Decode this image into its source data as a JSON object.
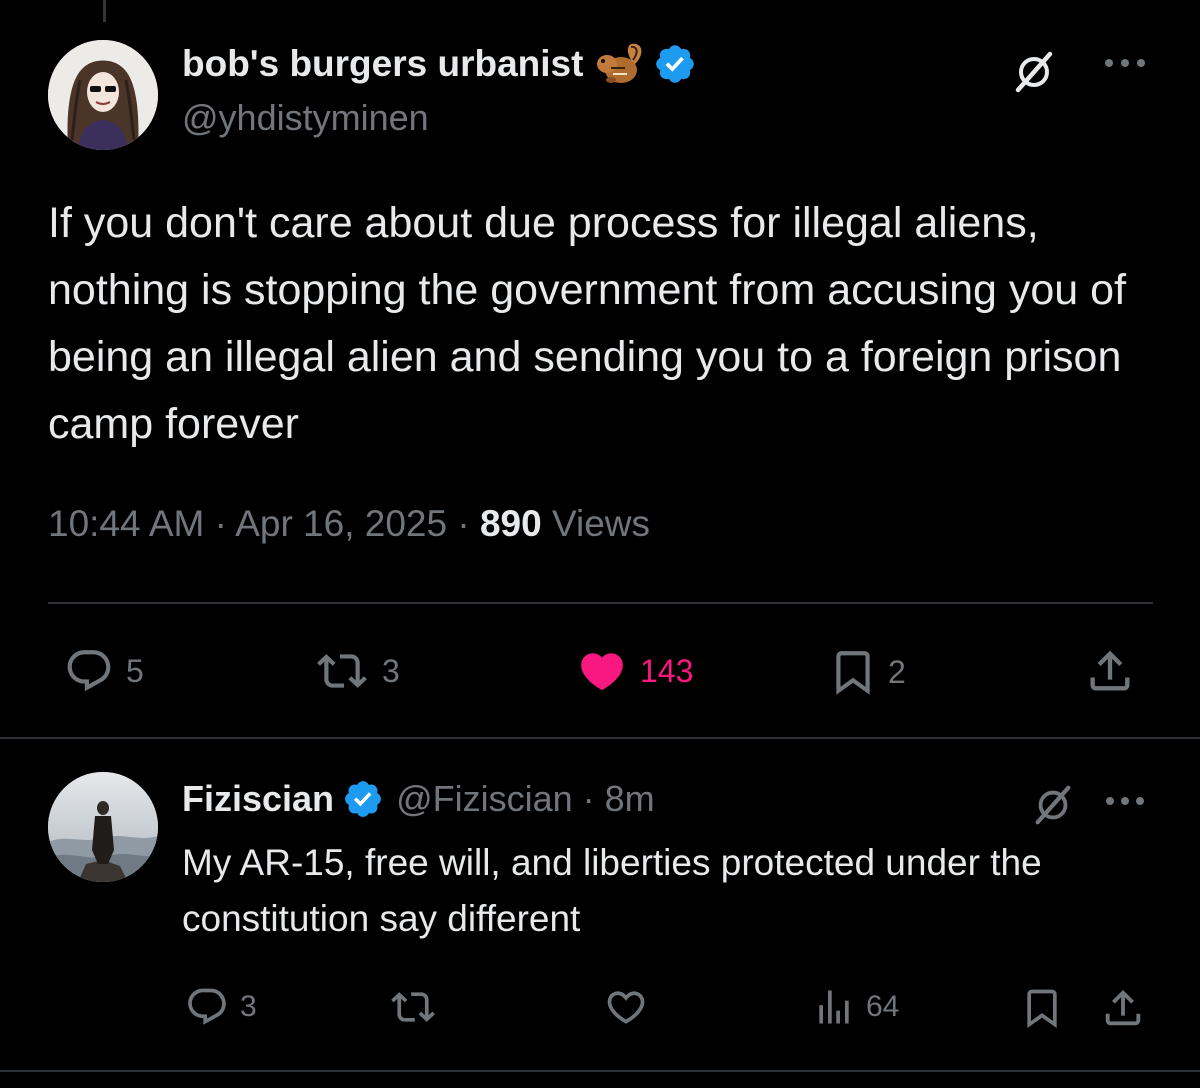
{
  "main_tweet": {
    "author_name": "bob's burgers urbanist",
    "author_emoji": "chipmunk-emoji",
    "author_handle": "@yhdistyminen",
    "text": "If you don't care about due process for illegal aliens, nothing is stopping the government from accusing you of being an illegal alien and sending you to a foreign prison camp forever",
    "time": "10:44 AM",
    "separator": "·",
    "date": "Apr 16, 2025",
    "views_count": "890",
    "views_label": "Views",
    "replies": "5",
    "reposts": "3",
    "likes": "143",
    "bookmarks": "2",
    "liked": true
  },
  "reply": {
    "author_name": "Fiziscian",
    "author_handle": "@Fiziscian",
    "separator": "·",
    "time_ago": "8m",
    "text": "My AR-15, free will, and liberties protected under the constitution say different",
    "replies": "3",
    "views": "64"
  },
  "colors": {
    "background": "#000000",
    "text_primary": "#e7e9ea",
    "text_secondary": "#71767b",
    "like_pink": "#f91880",
    "verified_blue": "#1d9bf0",
    "divider": "#2f3336"
  }
}
